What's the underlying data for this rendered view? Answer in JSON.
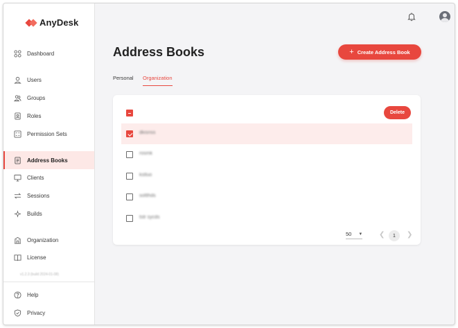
{
  "app": {
    "brand": "AnyDesk"
  },
  "colors": {
    "accent": "#e8473e",
    "sidebar_active_bg": "#fde8e6",
    "selected_row_bg": "#fdeceb"
  },
  "sidebar": {
    "items": [
      {
        "label": "Dashboard",
        "icon": "dashboard-icon"
      },
      {
        "label": "Users",
        "icon": "user-icon"
      },
      {
        "label": "Groups",
        "icon": "groups-icon"
      },
      {
        "label": "Roles",
        "icon": "roles-icon"
      },
      {
        "label": "Permission Sets",
        "icon": "permission-sets-icon"
      },
      {
        "label": "Address Books",
        "icon": "address-book-icon",
        "active": true
      },
      {
        "label": "Clients",
        "icon": "monitor-icon"
      },
      {
        "label": "Sessions",
        "icon": "sessions-icon"
      },
      {
        "label": "Builds",
        "icon": "builds-icon"
      },
      {
        "label": "Organization",
        "icon": "organization-icon"
      },
      {
        "label": "License",
        "icon": "license-icon"
      },
      {
        "label": "Help",
        "icon": "help-icon"
      },
      {
        "label": "Privacy",
        "icon": "shield-icon"
      }
    ],
    "version": "v1.2.3 (build 2024-01-08)"
  },
  "header": {
    "notifications_icon": "bell-icon",
    "avatar_icon": "avatar-icon"
  },
  "main": {
    "title": "Address Books",
    "create_button": "Create Address Book",
    "tabs": [
      {
        "label": "Personal",
        "active": false
      },
      {
        "label": "Organization",
        "active": true
      }
    ],
    "delete_button": "Delete",
    "rows": [
      {
        "name": "dkisnss",
        "checked": true
      },
      {
        "name": "rosmk",
        "checked": false
      },
      {
        "name": "kstluo",
        "checked": false
      },
      {
        "name": "soltlhds",
        "checked": false
      },
      {
        "name": "tstr sycds",
        "checked": false
      }
    ],
    "pagination": {
      "page_size": "50",
      "current_page": "1"
    }
  }
}
